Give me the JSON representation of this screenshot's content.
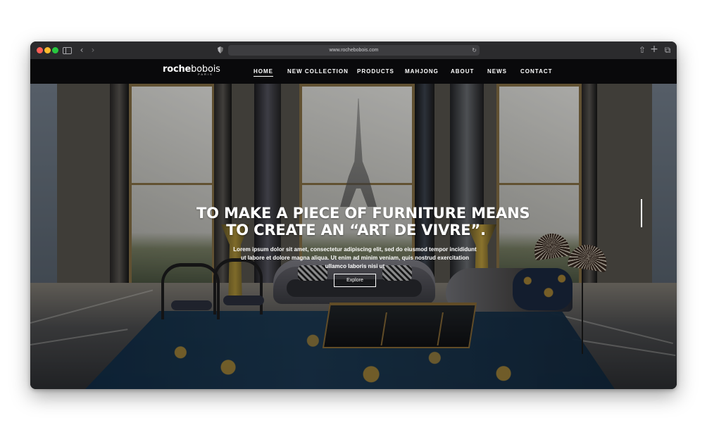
{
  "browser": {
    "url": "www.rochebobois.com",
    "icons": {
      "sidebar": "sidebar-icon",
      "back": "chevron-left-icon",
      "forward": "chevron-right-icon",
      "privacy": "shield-icon",
      "refresh": "refresh-icon",
      "share": "share-icon",
      "new_tab": "plus-icon",
      "tabs": "tabs-icon"
    }
  },
  "site": {
    "logo": {
      "primary": "roche",
      "secondary": "bobois",
      "sub": "PARIS"
    },
    "nav": [
      {
        "label": "HOME",
        "active": true
      },
      {
        "label": "NEW COLLECTION",
        "active": false
      },
      {
        "label": "PRODUCTS",
        "active": false
      },
      {
        "label": "MAHJONG",
        "active": false
      },
      {
        "label": "ABOUT",
        "active": false
      },
      {
        "label": "NEWS",
        "active": false
      },
      {
        "label": "CONTACT",
        "active": false
      }
    ]
  },
  "hero": {
    "headline_line1": "TO MAKE A PIECE OF FURNITURE MEANS",
    "headline_line2": "TO CREATE AN “ART DE VIVRE”.",
    "description": "Lorem ipsum dolor sit amet, consectetur adipiscing elit, sed do eiusmod tempor incididunt ut labore et dolore magna aliqua. Ut enim ad minim veniam, quis nostrud exercitation ullamco laboris nisi ut",
    "cta": "Explore",
    "favorite_icon": "heart-icon"
  },
  "colors": {
    "header": "#09090b",
    "text": "#ffffff",
    "accent_gold": "#8b6d39"
  }
}
